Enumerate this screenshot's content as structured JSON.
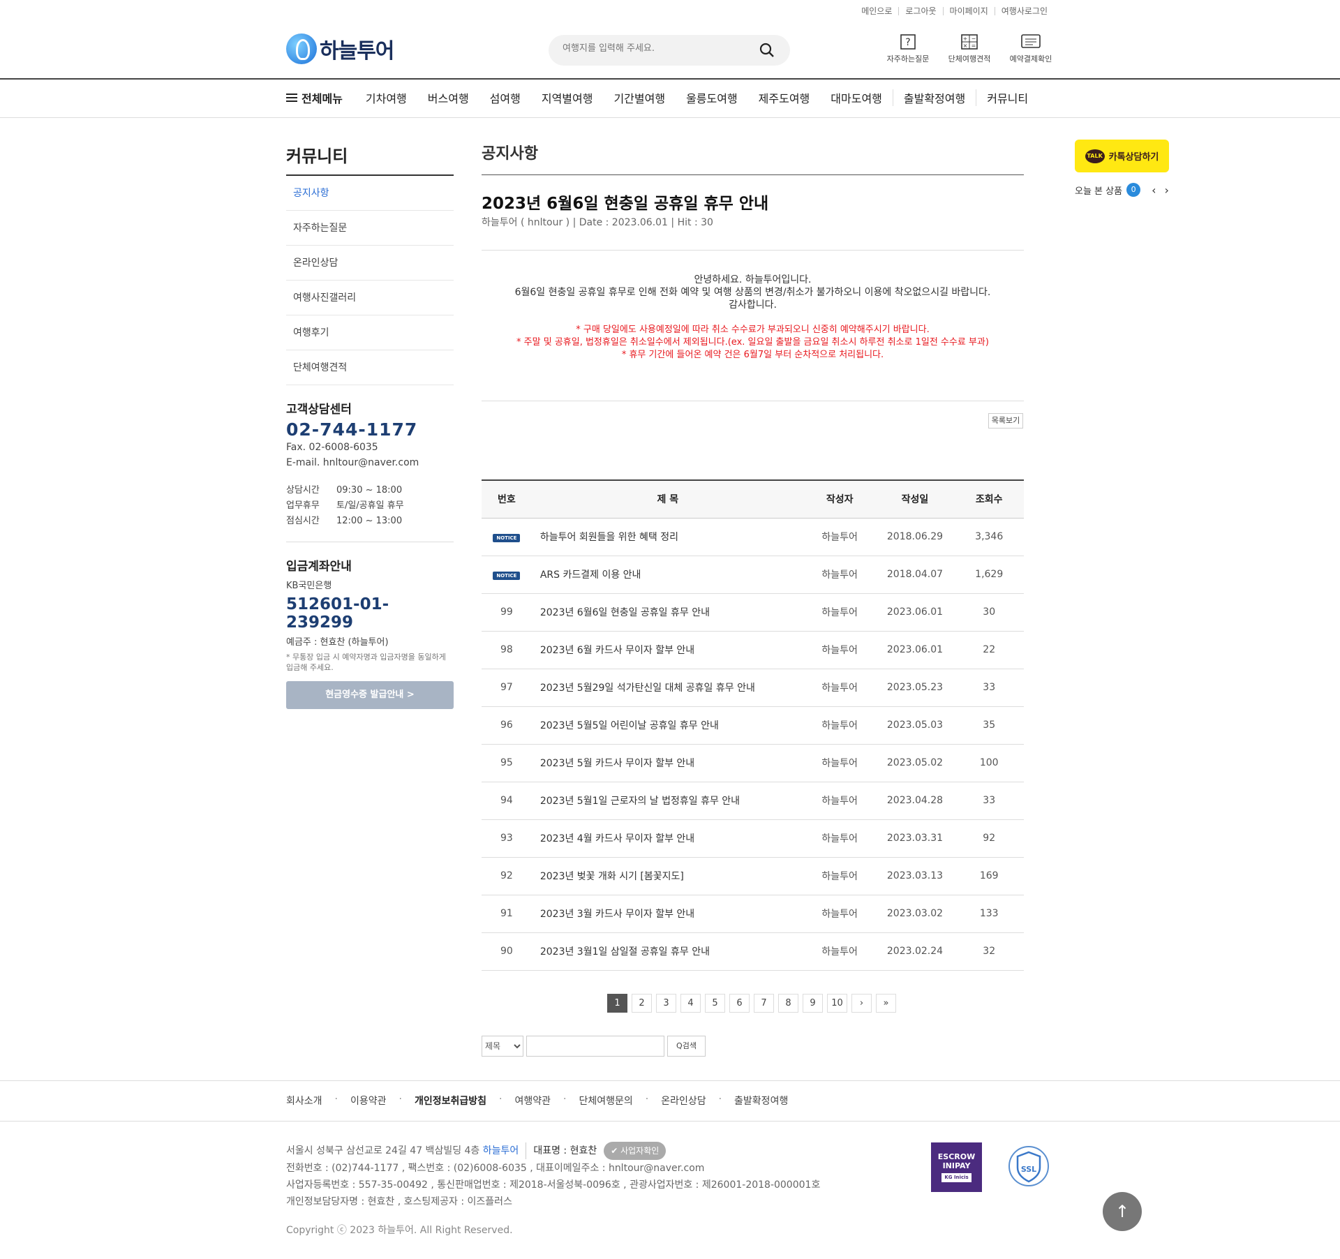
{
  "util_links": [
    "메인으로",
    "로그아웃",
    "마이페이지",
    "여행사로그인"
  ],
  "logo": {
    "text": "하늘투어"
  },
  "search": {
    "placeholder": "여행지를 입력해 주세요."
  },
  "quick_icons": [
    {
      "label": "자주하는질문",
      "icon": "question-icon"
    },
    {
      "label": "단체여행견적",
      "icon": "calculator-icon"
    },
    {
      "label": "예약결제확인",
      "icon": "list-icon"
    }
  ],
  "gnb": {
    "all_menu": "전체메뉴",
    "items": [
      "기차여행",
      "버스여행",
      "섬여행",
      "지역별여행",
      "기간별여행",
      "울릉도여행",
      "제주도여행",
      "대마도여행",
      "출발확정여행",
      "커뮤니티"
    ]
  },
  "sidebar": {
    "title": "커뮤니티",
    "menu": [
      "공지사항",
      "자주하는질문",
      "온라인상담",
      "여행사진갤러리",
      "여행후기",
      "단체여행견적"
    ],
    "active_index": 0,
    "cs_title": "고객상담센터",
    "tel": "02-744-1177",
    "fax": "Fax. 02-6008-6035",
    "email": "E-mail. hnltour@naver.com",
    "hours": [
      {
        "k": "상담시간",
        "v": "09:30 ~ 18:00"
      },
      {
        "k": "업무휴무",
        "v": "토/일/공휴일 휴무"
      },
      {
        "k": "점심시간",
        "v": "12:00 ~ 13:00"
      }
    ],
    "bank_title": "입금계좌안내",
    "bank_name": "KB국민은행",
    "account": "512601-01-239299",
    "owner": "예금주 : 현효찬 (하늘투어)",
    "note": "* 무통장 입금 시 예약자명과 입금자명을 동일하게 입금해 주세요.",
    "receipt_btn": "현금영수증 발급안내 >"
  },
  "main": {
    "title": "공지사항",
    "post": {
      "title": "2023년 6월6일 현충일 공휴일 휴무 안내",
      "meta": "하늘투어 ( hnltour ) | Date : 2023.06.01 | Hit : 30",
      "body_line1": "안녕하세요. 하늘투어입니다.",
      "body_line2": "6월6일 현충일 공휴일 휴무로 인해 전화 예약 및 여행 상품의 변경/취소가 불가하오니 이용에 착오없으시길 바랍니다.",
      "body_line3": "감사합니다.",
      "red_line1": "* 구매 당일에도 사용예정일에 따라 취소 수수료가 부과되오니 신중히 예약해주시기 바랍니다.",
      "red_line2": "* 주말 및 공휴일, 법정휴일은 취소일수에서 제외됩니다.(ex. 일요일 출발을 금요일 취소시 하루전 취소로 1일전 수수료 부과)",
      "red_line3": "* 휴무 기간에 들어온 예약 건은 6월7일 부터 순차적으로 처리됩니다."
    },
    "list_button": "목록보기",
    "table": {
      "headers": [
        "번호",
        "제 목",
        "작성자",
        "작성일",
        "조회수"
      ],
      "notice_badge": "NOTICE",
      "rows": [
        {
          "no": "NOTICE",
          "title": "하늘투어 회원들을 위한 혜택 정리",
          "author": "하늘투어",
          "date": "2018.06.29",
          "hits": "3,346"
        },
        {
          "no": "NOTICE",
          "title": "ARS 카드결제 이용 안내",
          "author": "하늘투어",
          "date": "2018.04.07",
          "hits": "1,629"
        },
        {
          "no": "99",
          "title": "2023년 6월6일 현충일 공휴일 휴무 안내",
          "author": "하늘투어",
          "date": "2023.06.01",
          "hits": "30"
        },
        {
          "no": "98",
          "title": "2023년 6월 카드사 무이자 할부 안내",
          "author": "하늘투어",
          "date": "2023.06.01",
          "hits": "22"
        },
        {
          "no": "97",
          "title": "2023년 5월29일 석가탄신일 대체 공휴일 휴무 안내",
          "author": "하늘투어",
          "date": "2023.05.23",
          "hits": "33"
        },
        {
          "no": "96",
          "title": "2023년 5월5일 어린이날 공휴일 휴무 안내",
          "author": "하늘투어",
          "date": "2023.05.03",
          "hits": "35"
        },
        {
          "no": "95",
          "title": "2023년 5월 카드사 무이자 할부 안내",
          "author": "하늘투어",
          "date": "2023.05.02",
          "hits": "100"
        },
        {
          "no": "94",
          "title": "2023년 5월1일 근로자의 날 법정휴일 휴무 안내",
          "author": "하늘투어",
          "date": "2023.04.28",
          "hits": "33"
        },
        {
          "no": "93",
          "title": "2023년 4월 카드사 무이자 할부 안내",
          "author": "하늘투어",
          "date": "2023.03.31",
          "hits": "92"
        },
        {
          "no": "92",
          "title": "2023년 벚꽃 개화 시기 [봄꽃지도]",
          "author": "하늘투어",
          "date": "2023.03.13",
          "hits": "169"
        },
        {
          "no": "91",
          "title": "2023년 3월 카드사 무이자 할부 안내",
          "author": "하늘투어",
          "date": "2023.03.02",
          "hits": "133"
        },
        {
          "no": "90",
          "title": "2023년 3월1일 삼일절 공휴일 휴무 안내",
          "author": "하늘투어",
          "date": "2023.02.24",
          "hits": "32"
        }
      ]
    },
    "paging": {
      "pages": [
        "1",
        "2",
        "3",
        "4",
        "5",
        "6",
        "7",
        "8",
        "9",
        "10"
      ],
      "current": "1",
      "next": "›",
      "last": "»"
    },
    "search_form": {
      "select": "제목",
      "button": "Q검색"
    }
  },
  "quick": {
    "kakao_badge": "TALK",
    "kakao_label": "카톡상담하기",
    "today_label": "오늘 본 상품",
    "today_count": "0"
  },
  "footer": {
    "links": [
      "회사소개",
      "이용약관",
      "개인정보취급방침",
      "여행약관",
      "단체여행문의",
      "온라인상담",
      "출발확정여행"
    ],
    "address_prefix": "서울시 성북구 삼선교로 24길 47 백삼빌딩 4층",
    "company": "하늘투어",
    "ceo": "대표명 : 현효찬",
    "biz_btn": "사업자확인",
    "line2": "전화번호 : (02)744-1177 , 팩스번호 : (02)6008-6035 , 대표이메일주소 : hnltour@naver.com",
    "line3": "사업자등록번호 : 557-35-00492 , 통신판매업번호 : 제2018-서울성북-0096호 , 관광사업자번호 : 제26001-2018-000001호",
    "line4": "개인정보담당자명 : 현효찬 , 호스팅제공자 : 이즈플러스",
    "copyright": "Copyright ⓒ 2023 하늘투어. All Right Reserved.",
    "escrow_line1": "ESCROW",
    "escrow_line2": "INIPAY",
    "escrow_sub": "KG Inicis",
    "ssl": "SSL"
  }
}
